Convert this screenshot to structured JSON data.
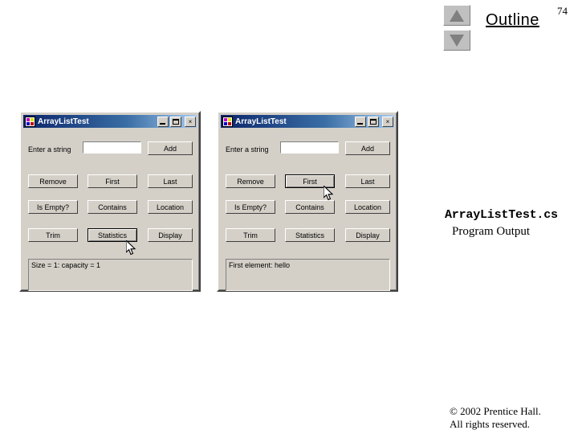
{
  "slide": {
    "outline_label": "Outline",
    "page_number": "74",
    "nav_up_icon": "triangle-up-icon",
    "nav_down_icon": "triangle-down-icon"
  },
  "caption": {
    "filename": "ArrayListTest.cs",
    "subtitle": "Program Output"
  },
  "footer": {
    "line1": "© 2002 Prentice Hall.",
    "line2": "All rights reserved."
  },
  "windows": [
    {
      "title": "ArrayListTest",
      "input_label": "Enter a string",
      "input_value": "",
      "buttons": [
        {
          "label": "Add",
          "focused": false
        },
        {
          "label": "Remove",
          "focused": false
        },
        {
          "label": "First",
          "focused": false
        },
        {
          "label": "Last",
          "focused": false
        },
        {
          "label": "Is Empty?",
          "focused": false
        },
        {
          "label": "Contains",
          "focused": false
        },
        {
          "label": "Location",
          "focused": false
        },
        {
          "label": "Trim",
          "focused": false
        },
        {
          "label": "Statistics",
          "focused": true
        },
        {
          "label": "Display",
          "focused": false
        }
      ],
      "output_text": "Size = 1: capacity = 1",
      "titlebar_buttons": {
        "minimize": "_",
        "maximize": "□",
        "close": "×"
      }
    },
    {
      "title": "ArrayListTest",
      "input_label": "Enter a string",
      "input_value": "",
      "buttons": [
        {
          "label": "Add",
          "focused": false
        },
        {
          "label": "Remove",
          "focused": false
        },
        {
          "label": "First",
          "focused": true
        },
        {
          "label": "Last",
          "focused": false
        },
        {
          "label": "Is Empty?",
          "focused": false
        },
        {
          "label": "Contains",
          "focused": false
        },
        {
          "label": "Location",
          "focused": false
        },
        {
          "label": "Trim",
          "focused": false
        },
        {
          "label": "Statistics",
          "focused": false
        },
        {
          "label": "Display",
          "focused": false
        }
      ],
      "output_text": "First element: hello",
      "titlebar_buttons": {
        "minimize": "_",
        "maximize": "□",
        "close": "×"
      }
    }
  ],
  "colors": {
    "window_face": "#d4d0c8",
    "titlebar_start": "#0a246a",
    "titlebar_end": "#a6caf0",
    "slide_background": "#ffffff"
  }
}
